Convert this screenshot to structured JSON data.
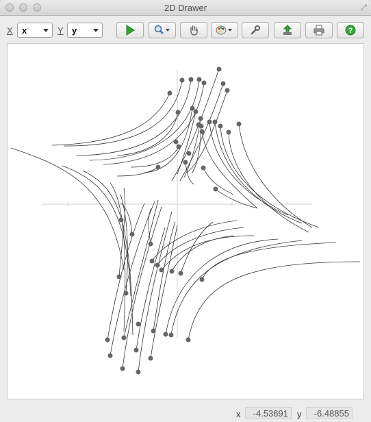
{
  "window": {
    "title": "2D Drawer"
  },
  "toolbar": {
    "x_label": "X",
    "x_value": "x",
    "y_label": "Y",
    "y_value": "y"
  },
  "status": {
    "x_label": "x",
    "x_value": "-4.53691",
    "y_label": "y",
    "y_value": "-6.48855"
  }
}
